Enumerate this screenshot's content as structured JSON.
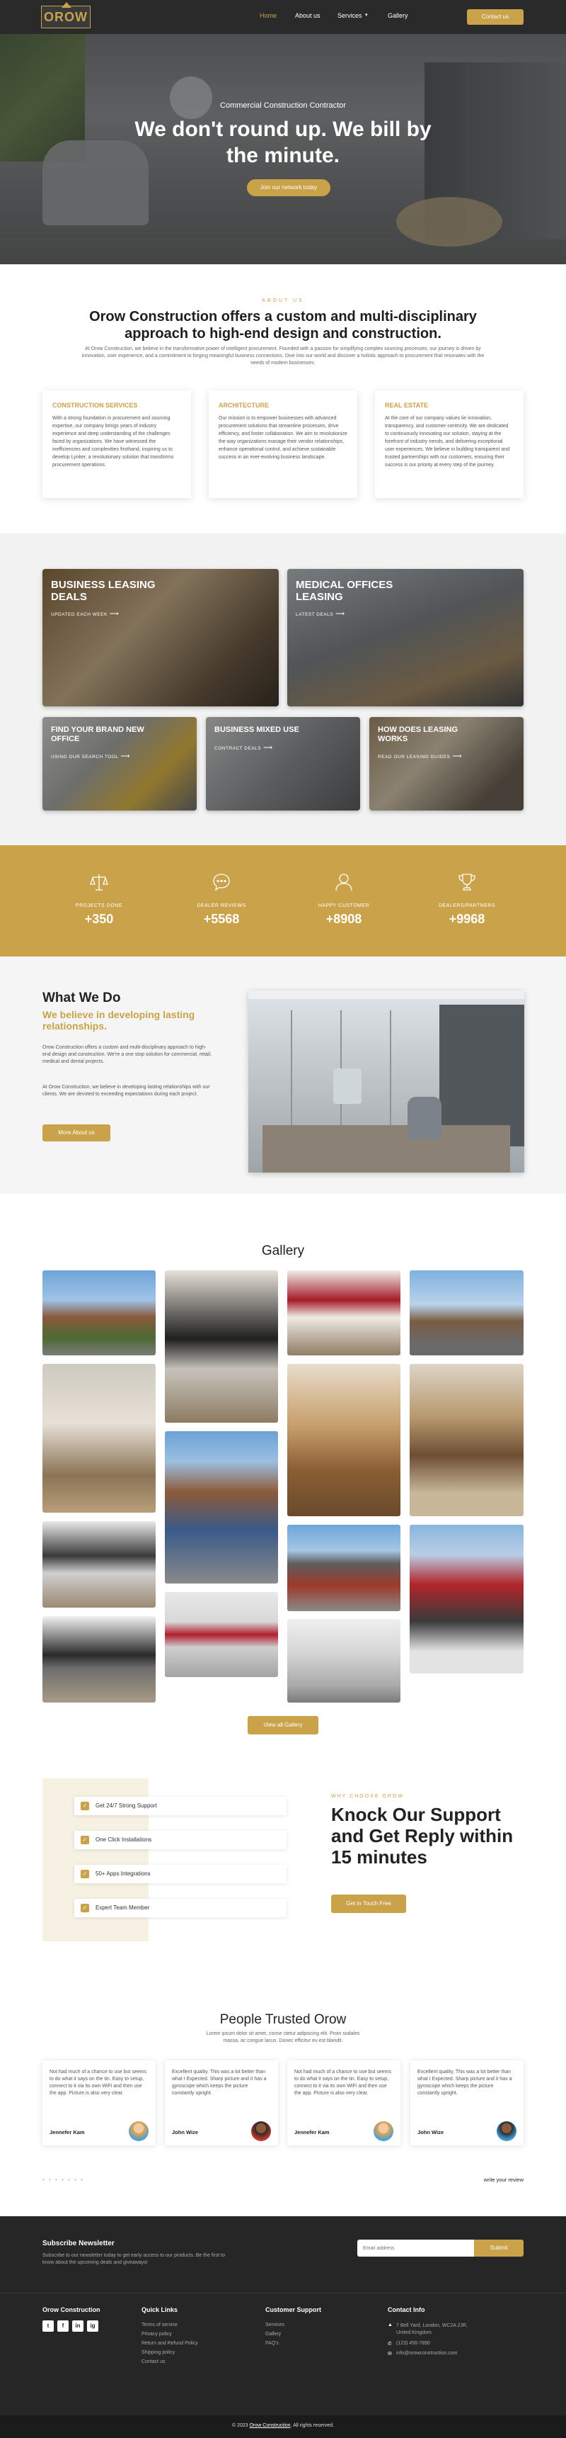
{
  "colors": {
    "accent": "#c9a24a",
    "dark": "#2a2a2a",
    "footer": "#262626"
  },
  "nav": {
    "logo": "OROW",
    "links": [
      "Home",
      "About us",
      "Services",
      "Gallery"
    ],
    "cta": "Contact us"
  },
  "hero": {
    "subtitle": "Commercial Construction Contractor",
    "title": "We don't round up. We bill by the minute.",
    "button": "Join our network today"
  },
  "about": {
    "kicker": "ABOUT US",
    "title": "Orow Construction offers a custom and multi-disciplinary approach to high-end design and construction.",
    "text": "At Orow Construction, we believe in the transformative power of intelligent procurement. Founded with a passion for simplifying complex sourcing processes, our journey is driven by innovation, user experience, and a commitment to forging meaningful business connections. Dive into our world and discover a holistic approach to procurement that resonates with the needs of modern businesses.",
    "cards": [
      {
        "title": "CONSTRUCTION SERVICES",
        "text": "With a strong foundation in procurement and sourcing expertise, our company brings years of industry experience and deep understanding of the challenges faced by organizations. We have witnessed the inefficiencies and complexities firsthand, inspiring us to develop Lynker, a revolutionary solution that transforms procurement operations."
      },
      {
        "title": "ARCHITECTURE",
        "text": "Our mission is to empower businesses with advanced procurement solutions that streamline processes, drive efficiency, and foster collaboration. We aim to revolutionize the way organizations manage their vendor relationships, enhance operational control, and achieve sustainable success in an ever-evolving business landscape."
      },
      {
        "title": "REAL ESTATE",
        "text": "At the core of our company values lie innovation, transparency, and customer-centricity. We are dedicated to continuously innovating our solution, staying at the forefront of industry trends, and delivering exceptional user experiences. We believe in building transparent and trusted partnerships with our customers, ensuring their success is our priority at every step of the journey."
      }
    ]
  },
  "tiles": [
    {
      "title": "BUSINESS LEASING DEALS",
      "link": "UPDATED EACH WEEK"
    },
    {
      "title": "MEDICAL OFFICES LEASING",
      "link": "LATEST DEALS"
    },
    {
      "title": "FIND YOUR BRAND NEW OFFICE",
      "link": "USING OUR SEARCH TOOL"
    },
    {
      "title": "BUSINESS MIXED USE",
      "link": "CONTRACT DEALS"
    },
    {
      "title": "HOW DOES LEASING WORKS",
      "link": "READ OUR LEASING GUIDES"
    }
  ],
  "stats": [
    {
      "icon": "scale-icon",
      "label": "PROJECTS DONE",
      "value": "+350"
    },
    {
      "icon": "chat-icon",
      "label": "DEALER REVIEWS",
      "value": "+5568"
    },
    {
      "icon": "user-icon",
      "label": "HAPPY CUSTOMER",
      "value": "+8908"
    },
    {
      "icon": "trophy-icon",
      "label": "DEALERS/PARTNERS",
      "value": "+9968"
    }
  ],
  "wwd": {
    "title": "What We Do",
    "subtitle": "We believe in developing lasting relationships.",
    "p1": "Orow Construction offers a custom and multi-disciplinary approach to high-end design and construction. We're a one stop solution for commercial, retail, medical and dental projects.",
    "p2": "At Orow Construction, we believe in developing lasting relationships with our clients. We are devoted to exceeding expectations during each project.",
    "button": "More About us"
  },
  "gallery": {
    "title": "Gallery",
    "button": "View all Gallery"
  },
  "support": {
    "items": [
      "Get 24/7 Strong Support",
      "One Click Installations",
      "50+ Apps Integrations",
      "Expert Team Member"
    ],
    "kicker": "WHY CHOOSE OROW",
    "title": "Knock Our Support and Get Reply within 15 minutes",
    "button": "Get in Touch Free"
  },
  "testimonials": {
    "title": "People Trusted Orow",
    "subtitle": "Lorem ipsum dolor sit amet, conse ctetur adipiscing elit. Proin sodales massa, ac congue lacus. Donec efficitur eu est blandit.",
    "cards": [
      {
        "text": "Not had much of a chance to use but seems to do what it says on the tin. Easy to setup, connect to it via its own WiFi and then use the app. Picture is also very clear.",
        "name": "Jennefer Kam"
      },
      {
        "text": "Excellent quality. This was a lot better than what I Expected. Sharp picture and it has a gyroscope which keeps the picture constantly upright.",
        "name": "John Wize"
      },
      {
        "text": "Not had much of a chance to use but seems to do what it says on the tin. Easy to setup, connect to it via its own WiFi and then use the app. Picture is also very clear.",
        "name": "Jennefer Kam"
      },
      {
        "text": "Excellent quality. This was a lot better than what I Expected. Sharp picture and it has a gyroscope which keeps the picture constantly upright.",
        "name": "John Wize"
      }
    ],
    "dots": "• • • • • • •",
    "write": "write your review"
  },
  "footer": {
    "nl_title": "Subscribe Newsletter",
    "nl_text": "Subscribe to our newsletter today to get early access to our products. Be the first to know about the upcoming deals and giveaways!",
    "nl_placeholder": "Email address",
    "nl_button": "Submit",
    "brand": "Orow Construction",
    "social": [
      "t",
      "f",
      "in",
      "ig"
    ],
    "quick_title": "Quick Links",
    "quick_links": [
      "Terms of service",
      "Privacy policy",
      "Return and Refund Policy",
      "Shipping policy",
      "Contact us"
    ],
    "support_title": "Customer Support",
    "support_links": [
      "Services",
      "Gallery",
      "FAQ's"
    ],
    "contact_title": "Contact Info",
    "contact_address": "7 Bell Yard, London, WC2A 2JR, United Kingdom",
    "contact_phone": "(123) 456-7890",
    "contact_email": "info@orowconstruction.com",
    "copy_prefix": "© 2023",
    "copy_link": "Orow Construction",
    "copy_suffix": ". All rights reserved."
  }
}
